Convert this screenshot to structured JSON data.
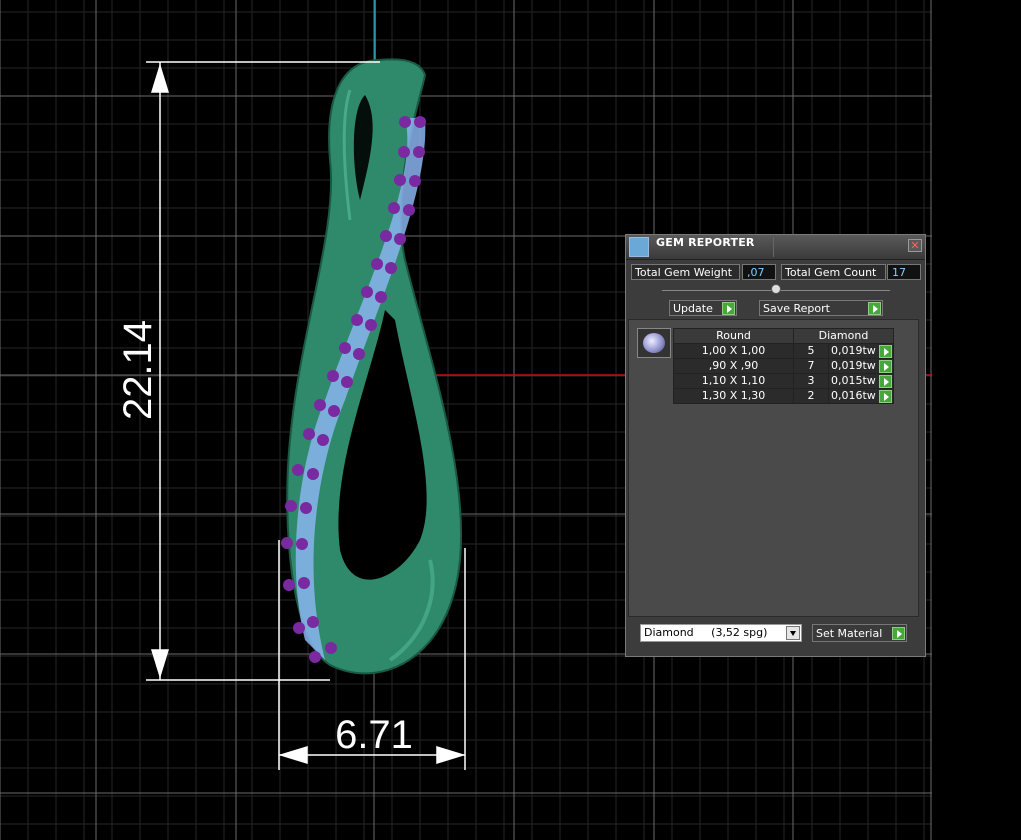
{
  "dimensions": {
    "height_label": "22.14",
    "width_label": "6.71"
  },
  "gem_reporter": {
    "title": "GEM REPORTER",
    "close_icon": "close-icon",
    "total_gem_weight_label": "Total Gem Weight",
    "total_gem_weight_value": ",07",
    "total_gem_count_label": "Total Gem Count",
    "total_gem_count_value": "17",
    "update_label": "Update",
    "save_report_label": "Save Report",
    "table": {
      "shape_header": "Round",
      "material_header": "Diamond",
      "rows": [
        {
          "size": "1,00 X 1,00",
          "count": "5",
          "weight": "0,019tw"
        },
        {
          "size": ",90 X ,90",
          "count": "7",
          "weight": "0,019tw"
        },
        {
          "size": "1,10 X 1,10",
          "count": "3",
          "weight": "0,015tw"
        },
        {
          "size": "1,30 X 1,30",
          "count": "2",
          "weight": "0,016tw"
        }
      ]
    },
    "material_select": "Diamond     (3,52 spg)",
    "set_material_label": "Set Material"
  },
  "colors": {
    "grid": "#555555",
    "metal": "#2e8a6a",
    "gem_blue": "#8ab4ee",
    "prong_purple": "#7a2aa0",
    "axis_red": "#c01010",
    "axis_cyan": "#1aa8c0",
    "go_green": "#46a83a"
  }
}
